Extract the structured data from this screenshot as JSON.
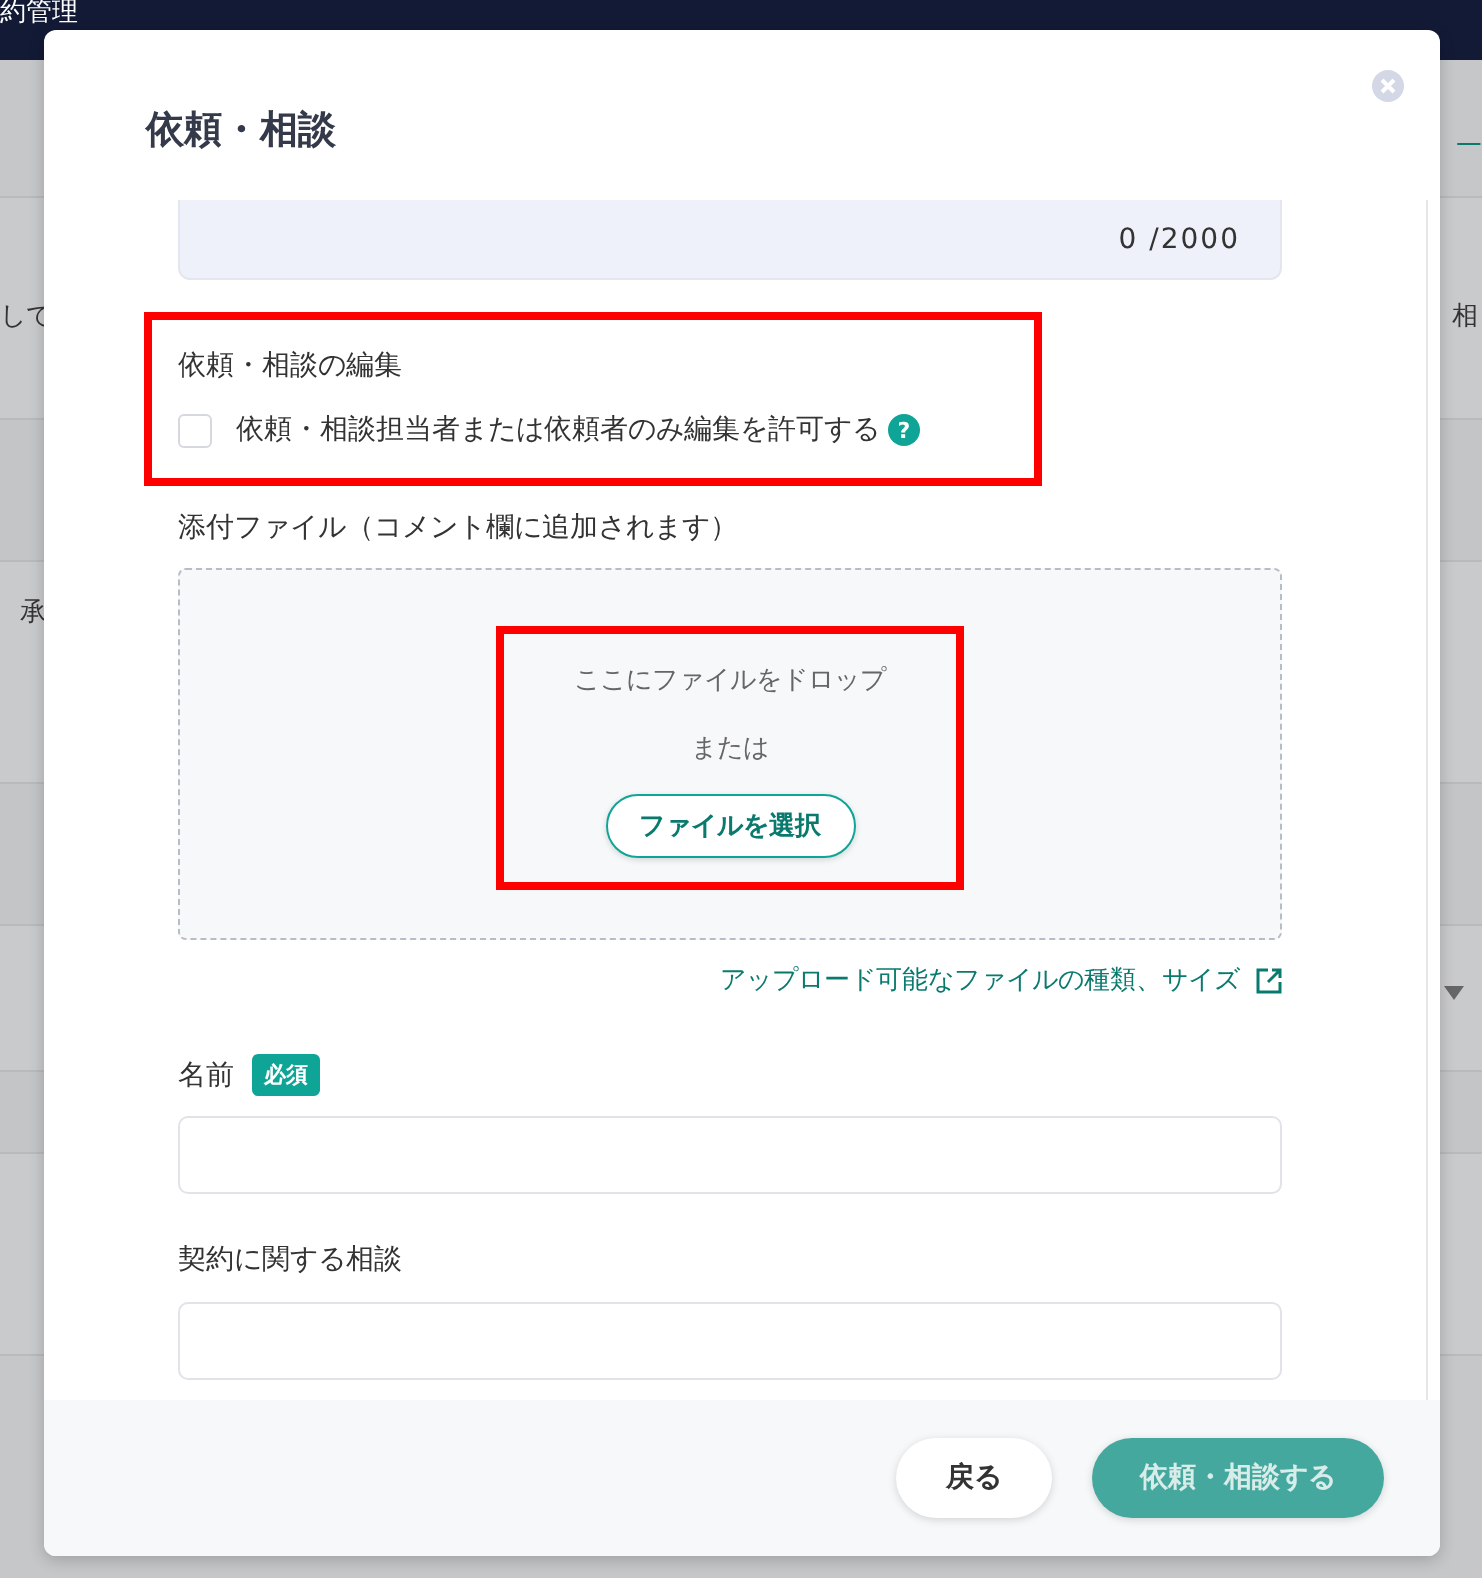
{
  "app_bar": {
    "title": "約管理"
  },
  "background_fragments": [
    {
      "text": "一",
      "kind": "link"
    },
    {
      "text": "して",
      "kind": "text"
    },
    {
      "text": "相",
      "kind": "text"
    },
    {
      "text": "承",
      "kind": "text"
    }
  ],
  "dialog": {
    "title": "依頼・相談",
    "counter": "0 /2000",
    "edit_section": {
      "highlighted": true,
      "heading": "依頼・相談の編集",
      "checkbox": {
        "label": "依頼・相談担当者または依頼者のみ編集を許可する",
        "checked": false,
        "help": "?"
      }
    },
    "attachments": {
      "label": "添付ファイル（コメント欄に追加されます）",
      "highlighted": true,
      "drop_text": "ここにファイルをドロップ",
      "or_text": "または",
      "button": "ファイルを選択",
      "link": "アップロード可能なファイルの種類、サイズ"
    },
    "fields": [
      {
        "label": "名前",
        "badge": "必須"
      },
      {
        "label": "契約に関する相談"
      }
    ],
    "buttons": [
      {
        "label": "戻る",
        "kind": "secondary",
        "disabled": false
      },
      {
        "label": "依頼・相談する",
        "kind": "primary",
        "disabled": true
      }
    ]
  }
}
